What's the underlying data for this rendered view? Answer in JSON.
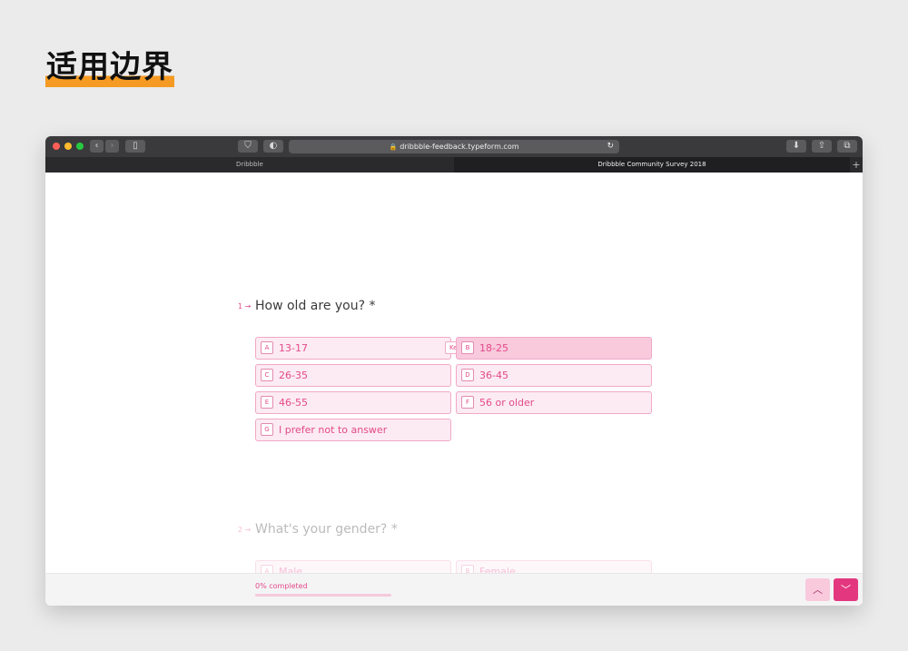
{
  "page": {
    "heading": "适用边界"
  },
  "browser": {
    "url": "dribbble-feedback.typeform.com",
    "tabs": [
      {
        "label": "Dribbble",
        "active": false
      },
      {
        "label": "Dribbble Community Survey 2018",
        "active": true
      }
    ],
    "traffic_colors": [
      "#ff5f57",
      "#febc2e",
      "#28c840"
    ]
  },
  "survey": {
    "q1": {
      "number": "1 →",
      "text": "How old are you? *",
      "choices": [
        {
          "key": "A",
          "label": "13-17"
        },
        {
          "key": "B",
          "label": "18-25",
          "selected": true
        },
        {
          "key": "C",
          "label": "26-35"
        },
        {
          "key": "D",
          "label": "36-45"
        },
        {
          "key": "E",
          "label": "46-55"
        },
        {
          "key": "F",
          "label": "56 or older"
        },
        {
          "key": "G",
          "label": "I prefer not to answer"
        }
      ],
      "key_hint": "Key"
    },
    "q2": {
      "number": "2 →",
      "text": "What's your gender? *",
      "choices": [
        {
          "key": "A",
          "label": "Male"
        },
        {
          "key": "B",
          "label": "Female"
        }
      ]
    }
  },
  "footer": {
    "progress_text": "0% completed",
    "progress_fraction": 0,
    "up_icon": "chevron-up-icon",
    "down_icon": "chevron-down-icon"
  },
  "colors": {
    "accent": "#e34a8a",
    "highlight": "#f59a23"
  }
}
